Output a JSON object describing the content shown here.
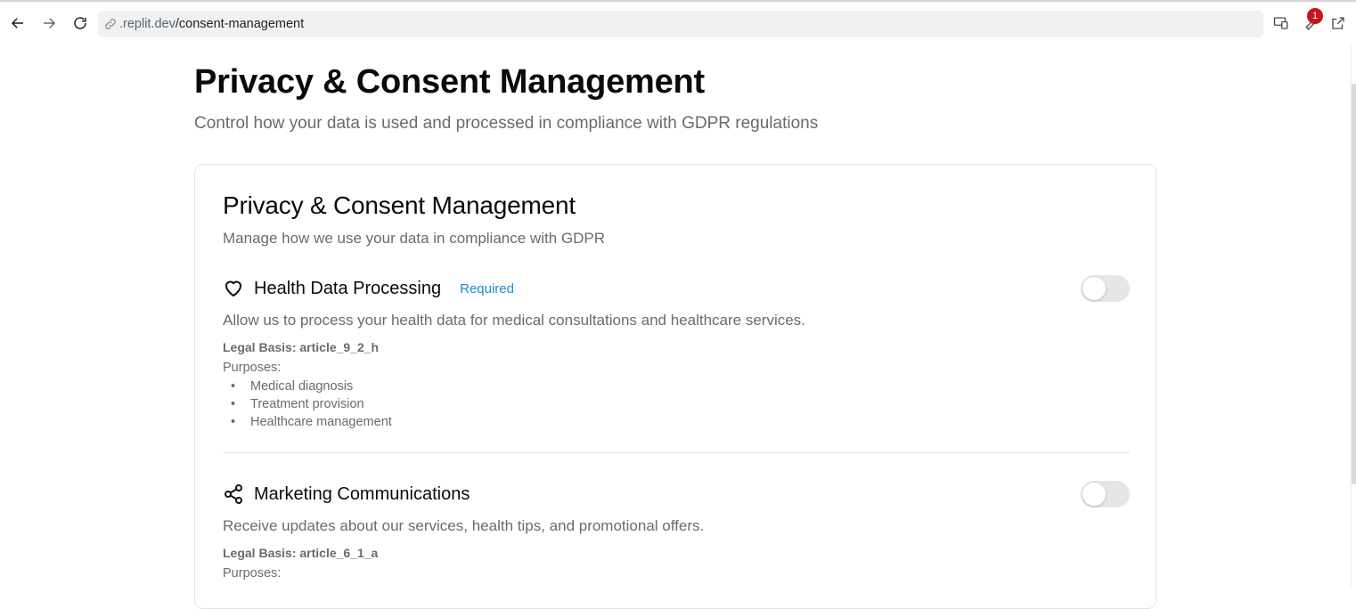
{
  "browser": {
    "url_prefix": ".replit.dev",
    "url_path": "/consent-management",
    "notification_count": "1"
  },
  "page": {
    "title": "Privacy & Consent Management",
    "subtitle": "Control how your data is used and processed in compliance with GDPR regulations"
  },
  "card": {
    "title": "Privacy & Consent Management",
    "description": "Manage how we use your data in compliance with GDPR",
    "consents": [
      {
        "icon": "heart-icon",
        "name": "Health Data Processing",
        "badge": "Required",
        "enabled": false,
        "description": "Allow us to process your health data for medical consultations and healthcare services.",
        "legal_basis": "Legal Basis: article_9_2_h",
        "purposes_label": "Purposes:",
        "purposes": [
          "Medical diagnosis",
          "Treatment provision",
          "Healthcare management"
        ]
      },
      {
        "icon": "share-icon",
        "name": "Marketing Communications",
        "badge": "",
        "enabled": false,
        "description": "Receive updates about our services, health tips, and promotional offers.",
        "legal_basis": "Legal Basis: article_6_1_a",
        "purposes_label": "Purposes:",
        "purposes": []
      }
    ]
  },
  "colors": {
    "accent": "#1a8bd6",
    "badge": "#c4161c",
    "muted_text": "#6b6b6b",
    "toggle_off": "#e6e6e6"
  }
}
